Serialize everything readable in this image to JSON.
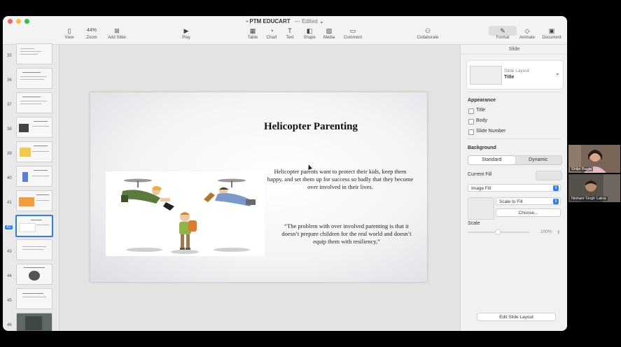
{
  "window": {
    "doc_name": "PTM EDUCART",
    "edited_label": "— Edited",
    "chevron": "⌄"
  },
  "toolbar": {
    "view": "View",
    "zoom_value": "44%",
    "zoom": "Zoom",
    "add_slide": "Add Slide",
    "play": "Play",
    "table": "Table",
    "chart": "Chart",
    "text": "Text",
    "shape": "Shape",
    "media": "Media",
    "comment": "Comment",
    "collaborate": "Collaborate",
    "format": "Format",
    "animate": "Animate",
    "document": "Document"
  },
  "slides": [
    {
      "num": "35"
    },
    {
      "num": "36"
    },
    {
      "num": "37"
    },
    {
      "num": "38"
    },
    {
      "num": "39"
    },
    {
      "num": "40"
    },
    {
      "num": "41"
    },
    {
      "num": "42"
    },
    {
      "num": "43"
    },
    {
      "num": "44"
    },
    {
      "num": "45"
    },
    {
      "num": "46"
    }
  ],
  "slide": {
    "title": "Helicopter Parenting",
    "body1": "Helicopter parents want to protect their kids, keep them happy, and set them up for success so badly that they become over involved in their lives.",
    "body2": "“The problem with over involved parenting is that it doesn’t prepare children for the real world and doesn’t equip them with resiliency,”"
  },
  "inspector": {
    "header": "Slide",
    "layout_label": "Slide Layout",
    "layout_value": "Title",
    "appearance": "Appearance",
    "title_opt": "Title",
    "body_opt": "Body",
    "slide_number_opt": "Slide Number",
    "background": "Background",
    "standard": "Standard",
    "dynamic": "Dynamic",
    "current_fill": "Current Fill",
    "fill_type": "Image Fill",
    "scale_mode": "Scale to Fill",
    "choose": "Choose...",
    "scale": "Scale",
    "scale_value": "100%",
    "edit_layout": "Edit Slide Layout"
  },
  "participants": [
    {
      "name": "Shilpi Bagla"
    },
    {
      "name": "Nishant Singh Lakra"
    }
  ]
}
